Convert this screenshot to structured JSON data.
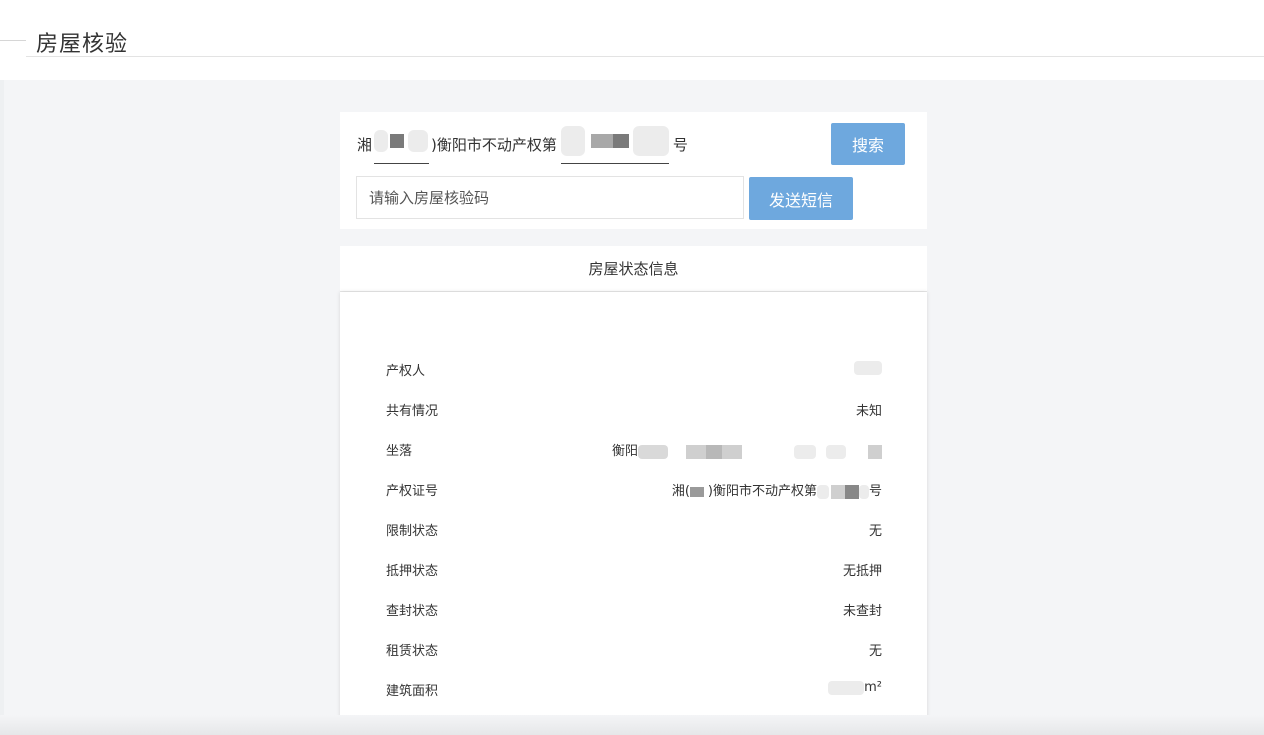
{
  "header": {
    "title": "房屋核验"
  },
  "search": {
    "cert_prefix": "湘",
    "cert_middle": ")衡阳市不动产权第",
    "cert_suffix": "号",
    "search_label": "搜索",
    "code_placeholder": "请输入房屋核验码",
    "sms_label": "发送短信"
  },
  "status": {
    "title": "房屋状态信息",
    "rows": [
      {
        "label": "产权人",
        "value": ""
      },
      {
        "label": "共有情况",
        "value": "未知"
      },
      {
        "label": "坐落",
        "value": "衡阳"
      },
      {
        "label": "产权证号",
        "value_prefix": "湘(",
        "value_middle": ")衡阳市不动产权第",
        "value_suffix": "号"
      },
      {
        "label": "限制状态",
        "value": "无"
      },
      {
        "label": "抵押状态",
        "value": "无抵押"
      },
      {
        "label": "查封状态",
        "value": "未查封"
      },
      {
        "label": "租赁状态",
        "value": "无"
      },
      {
        "label": "建筑面积",
        "value": "m²"
      }
    ]
  },
  "colors": {
    "accent": "#6ea8de",
    "background": "#f4f5f7"
  }
}
